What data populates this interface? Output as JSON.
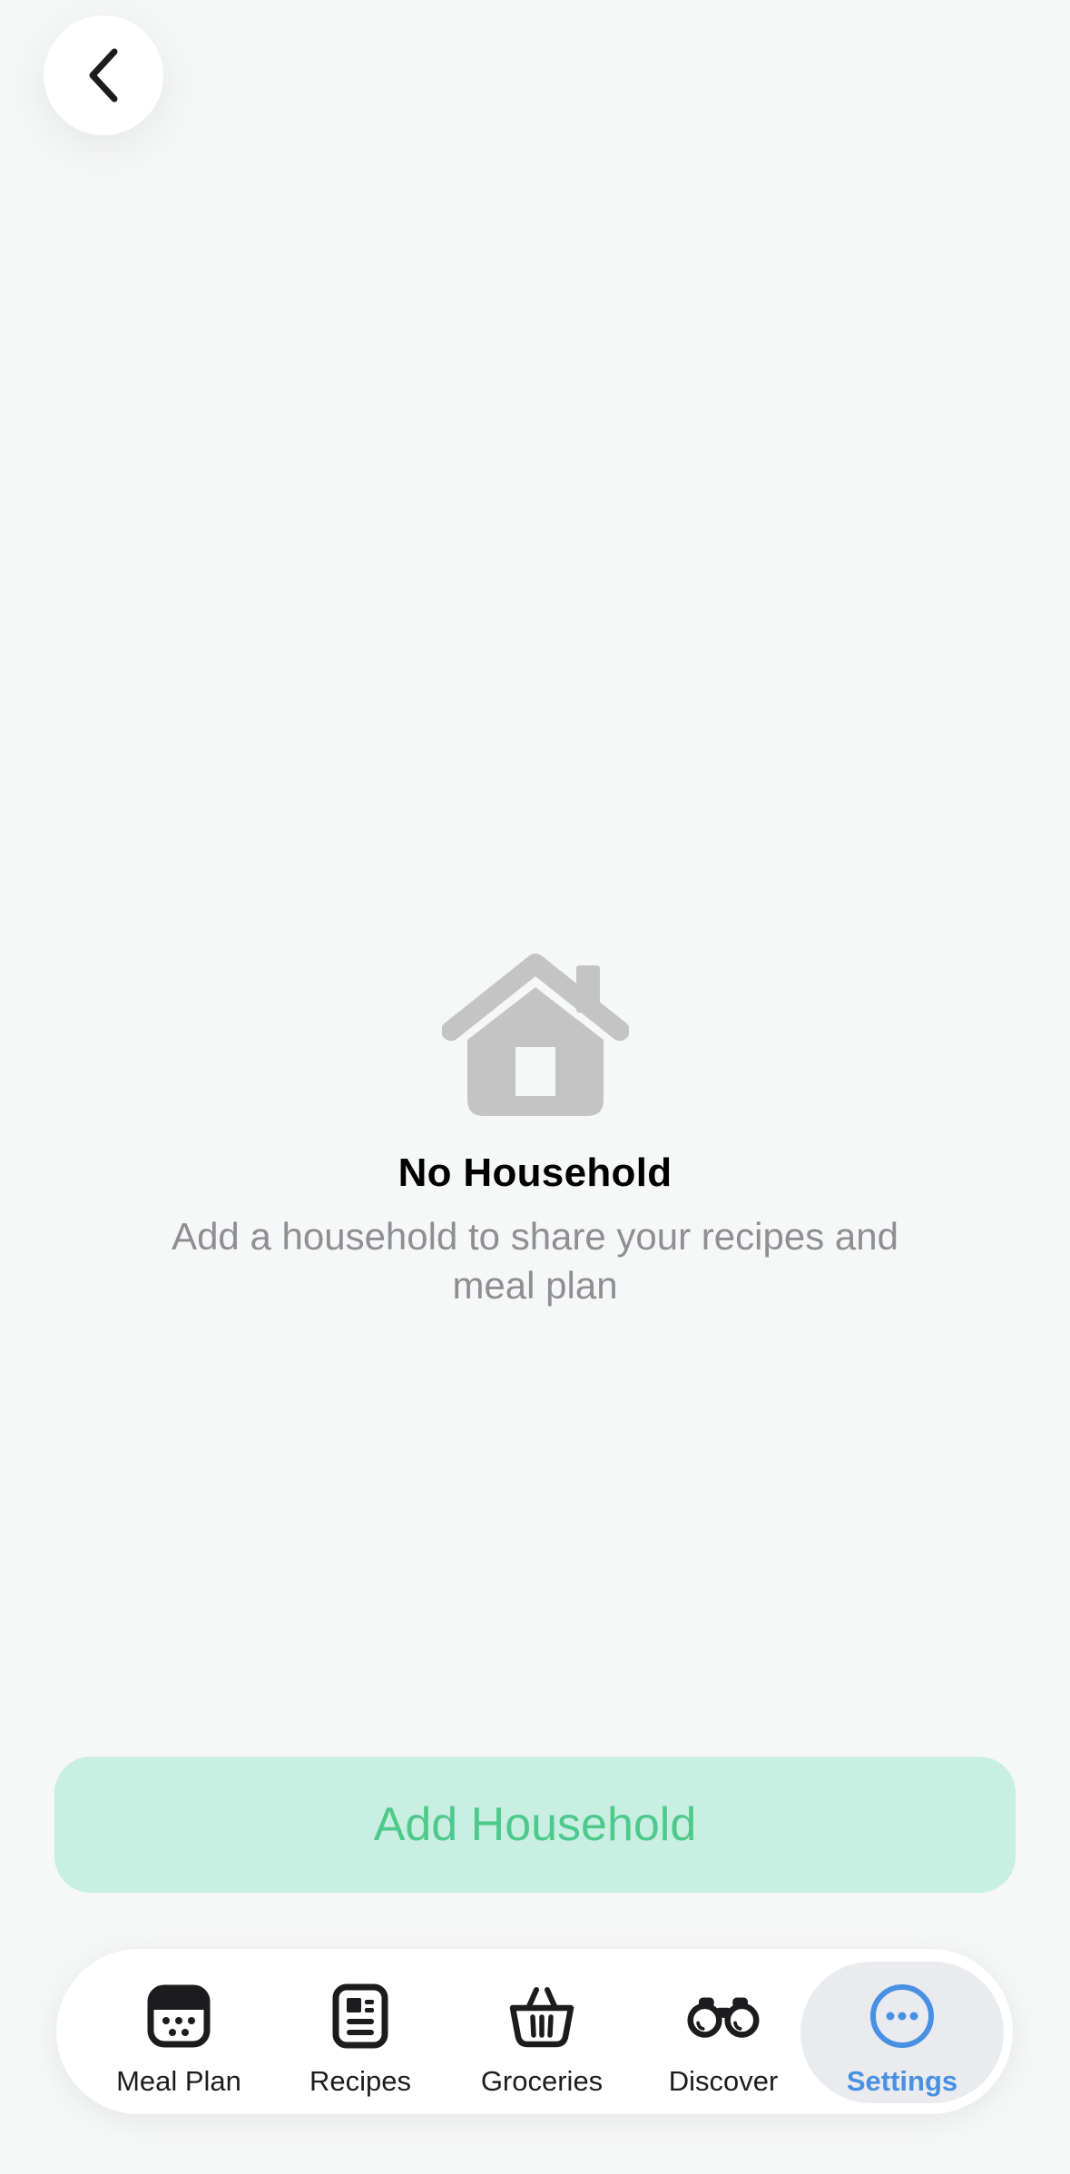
{
  "header": {
    "back_icon": "chevron-left-icon"
  },
  "empty_state": {
    "icon": "house-icon",
    "title": "No Household",
    "description": "Add a household to share your recipes and meal plan"
  },
  "primary_action": {
    "label": "Add Household",
    "background_color": "#c9eee2",
    "text_color": "#4ec98c"
  },
  "tab_bar": {
    "active_color": "#4a90e2",
    "tabs": [
      {
        "label": "Meal Plan",
        "icon": "calendar-icon",
        "active": false
      },
      {
        "label": "Recipes",
        "icon": "recipe-card-icon",
        "active": false
      },
      {
        "label": "Groceries",
        "icon": "basket-icon",
        "active": false
      },
      {
        "label": "Discover",
        "icon": "binoculars-icon",
        "active": false
      },
      {
        "label": "Settings",
        "icon": "ellipsis-circle-icon",
        "active": true
      }
    ]
  }
}
